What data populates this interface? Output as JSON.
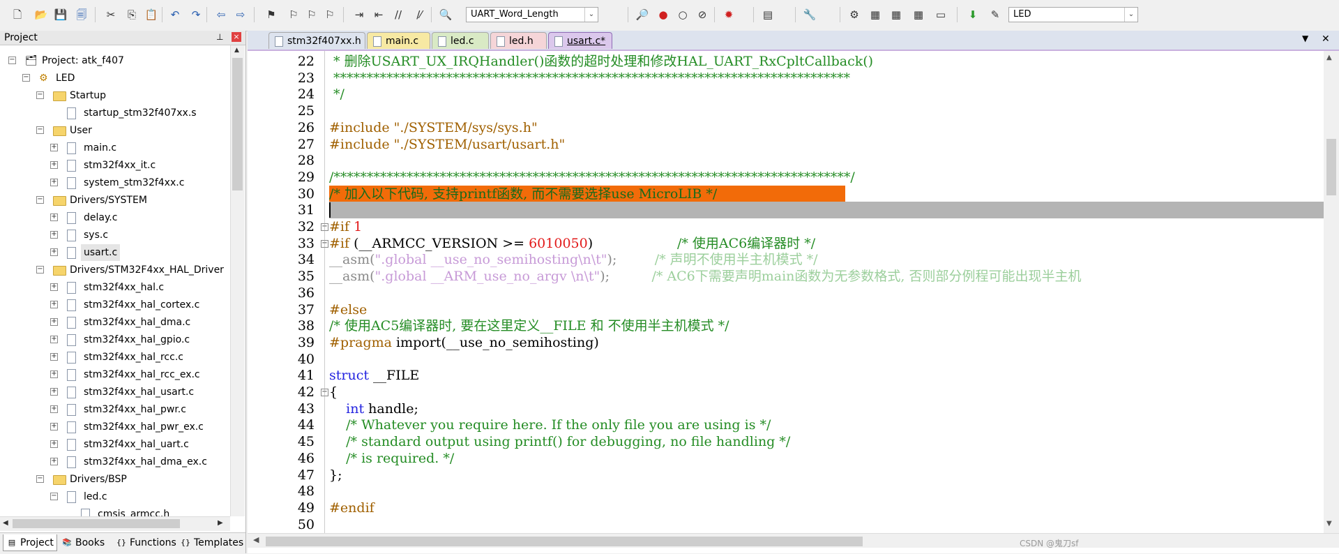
{
  "toolbar": {
    "target_combo": "UART_Word_Length",
    "project_combo": "LED",
    "icons": [
      "new-file-icon",
      "open-folder-icon",
      "save-icon",
      "save-all-icon",
      "cut-icon",
      "copy-icon",
      "paste-icon",
      "undo-icon",
      "redo-icon",
      "nav-back-icon",
      "nav-forward-icon",
      "bookmark-icon",
      "bookmark-prev-icon",
      "bookmark-next-icon",
      "bookmark-clear-icon",
      "indent-icon",
      "unindent-icon",
      "comment-icon",
      "uncomment-icon",
      "find-in-files-icon",
      "find-icon",
      "debug-start-icon",
      "breakpoint-icon",
      "breakpoint-disable-icon",
      "breakpoint-kill-icon",
      "window-layout-icon",
      "configure-icon",
      "translate-icon",
      "build-icon",
      "rebuild-icon",
      "batch-build-icon",
      "stop-build-icon",
      "download-icon",
      "target-options-icon",
      "manage-components-icon",
      "pack-installer-icon",
      "select-packs-icon",
      "run-env-icon"
    ]
  },
  "project_panel": {
    "title": "Project",
    "close_label": "×",
    "tree": [
      {
        "label": "Project: atk_f407",
        "depth": 0,
        "kind": "project",
        "expand": "−"
      },
      {
        "label": "LED",
        "depth": 1,
        "kind": "target",
        "expand": "−"
      },
      {
        "label": "Startup",
        "depth": 2,
        "kind": "folder",
        "expand": "−"
      },
      {
        "label": "startup_stm32f407xx.s",
        "depth": 3,
        "kind": "file",
        "expand": ""
      },
      {
        "label": "User",
        "depth": 2,
        "kind": "folder",
        "expand": "−"
      },
      {
        "label": "main.c",
        "depth": 3,
        "kind": "file",
        "expand": "+"
      },
      {
        "label": "stm32f4xx_it.c",
        "depth": 3,
        "kind": "file",
        "expand": "+"
      },
      {
        "label": "system_stm32f4xx.c",
        "depth": 3,
        "kind": "file",
        "expand": "+"
      },
      {
        "label": "Drivers/SYSTEM",
        "depth": 2,
        "kind": "folder",
        "expand": "−"
      },
      {
        "label": "delay.c",
        "depth": 3,
        "kind": "file",
        "expand": "+"
      },
      {
        "label": "sys.c",
        "depth": 3,
        "kind": "file",
        "expand": "+"
      },
      {
        "label": "usart.c",
        "depth": 3,
        "kind": "file",
        "expand": "+",
        "selected": true
      },
      {
        "label": "Drivers/STM32F4xx_HAL_Driver",
        "depth": 2,
        "kind": "folder",
        "expand": "−"
      },
      {
        "label": "stm32f4xx_hal.c",
        "depth": 3,
        "kind": "file",
        "expand": "+"
      },
      {
        "label": "stm32f4xx_hal_cortex.c",
        "depth": 3,
        "kind": "file",
        "expand": "+"
      },
      {
        "label": "stm32f4xx_hal_dma.c",
        "depth": 3,
        "kind": "file",
        "expand": "+"
      },
      {
        "label": "stm32f4xx_hal_gpio.c",
        "depth": 3,
        "kind": "file",
        "expand": "+"
      },
      {
        "label": "stm32f4xx_hal_rcc.c",
        "depth": 3,
        "kind": "file",
        "expand": "+"
      },
      {
        "label": "stm32f4xx_hal_rcc_ex.c",
        "depth": 3,
        "kind": "file",
        "expand": "+"
      },
      {
        "label": "stm32f4xx_hal_usart.c",
        "depth": 3,
        "kind": "file",
        "expand": "+"
      },
      {
        "label": "stm32f4xx_hal_pwr.c",
        "depth": 3,
        "kind": "file",
        "expand": "+"
      },
      {
        "label": "stm32f4xx_hal_pwr_ex.c",
        "depth": 3,
        "kind": "file",
        "expand": "+"
      },
      {
        "label": "stm32f4xx_hal_uart.c",
        "depth": 3,
        "kind": "file",
        "expand": "+"
      },
      {
        "label": "stm32f4xx_hal_dma_ex.c",
        "depth": 3,
        "kind": "file",
        "expand": "+"
      },
      {
        "label": "Drivers/BSP",
        "depth": 2,
        "kind": "folder",
        "expand": "−"
      },
      {
        "label": "led.c",
        "depth": 3,
        "kind": "file",
        "expand": "−"
      },
      {
        "label": "cmsis_armcc.h",
        "depth": 4,
        "kind": "file",
        "expand": ""
      }
    ],
    "bottom_tabs": [
      {
        "label": "Project",
        "icon": "project-tab-icon",
        "active": true
      },
      {
        "label": "Books",
        "icon": "books-tab-icon",
        "active": false
      },
      {
        "label": "Functions",
        "icon": "functions-tab-icon",
        "active": false
      },
      {
        "label": "Templates",
        "icon": "templates-tab-icon",
        "active": false
      }
    ]
  },
  "editor": {
    "tabs": [
      {
        "label": "stm32f407xx.h",
        "color": "#dde3ee",
        "active": false
      },
      {
        "label": "main.c",
        "color": "#f7e9a3",
        "active": false
      },
      {
        "label": "led.c",
        "color": "#d9eac5",
        "active": false
      },
      {
        "label": "led.h",
        "color": "#f5d5d8",
        "active": false
      },
      {
        "label": "usart.c*",
        "color": "#dbc8ec",
        "active": true
      }
    ],
    "tab_menu": "▼",
    "tab_close": "✕",
    "lines": [
      {
        "n": "22",
        "fold": "",
        "hl": "",
        "segs": [
          {
            "t": " * 删除USART_UX_IRQHandler()函数的超时处理和修改HAL_UART_RxCpltCallback()",
            "c": "#248c24"
          }
        ]
      },
      {
        "n": "23",
        "fold": "",
        "hl": "",
        "segs": [
          {
            "t": " ******************************************************************************",
            "c": "#248c24"
          }
        ]
      },
      {
        "n": "24",
        "fold": "",
        "hl": "",
        "segs": [
          {
            "t": " */",
            "c": "#248c24"
          }
        ]
      },
      {
        "n": "25",
        "fold": "",
        "hl": "",
        "segs": []
      },
      {
        "n": "26",
        "fold": "",
        "hl": "",
        "segs": [
          {
            "t": "#include ",
            "c": "#a06000"
          },
          {
            "t": "\"./SYSTEM/sys/sys.h\"",
            "c": "#a06000"
          }
        ]
      },
      {
        "n": "27",
        "fold": "",
        "hl": "",
        "segs": [
          {
            "t": "#include ",
            "c": "#a06000"
          },
          {
            "t": "\"./SYSTEM/usart/usart.h\"",
            "c": "#a06000"
          }
        ]
      },
      {
        "n": "28",
        "fold": "",
        "hl": "",
        "segs": []
      },
      {
        "n": "29",
        "fold": "",
        "hl": "",
        "segs": [
          {
            "t": "/******************************************************************************/",
            "c": "#248c24"
          }
        ]
      },
      {
        "n": "30",
        "fold": "",
        "hl": "orange",
        "segs": [
          {
            "t": "/* 加入以下代码, 支持printf函数, 而不需要选择use MicroLIB */",
            "c": "#1a6a1a"
          }
        ]
      },
      {
        "n": "31",
        "fold": "",
        "hl": "gray",
        "segs": []
      },
      {
        "n": "32",
        "fold": "−",
        "hl": "",
        "segs": [
          {
            "t": "#if ",
            "c": "#a06000"
          },
          {
            "t": "1",
            "c": "#e21a1a"
          }
        ]
      },
      {
        "n": "33",
        "fold": "−",
        "hl": "",
        "segs": [
          {
            "t": "#if ",
            "c": "#a06000"
          },
          {
            "t": "(__ARMCC_VERSION >= ",
            "c": "#000000"
          },
          {
            "t": "6010050",
            "c": "#e21a1a"
          },
          {
            "t": ")                    ",
            "c": "#000000"
          },
          {
            "t": "/* 使用AC6编译器时 */",
            "c": "#248c24"
          }
        ]
      },
      {
        "n": "34",
        "fold": "",
        "hl": "",
        "segs": [
          {
            "t": "__asm(",
            "c": "#8a8a8a"
          },
          {
            "t": "\".global __use_no_semihosting\\n\\t\"",
            "c": "#c79ad7"
          },
          {
            "t": ");         ",
            "c": "#8a8a8a"
          },
          {
            "t": "/* 声明不使用半主机模式 */",
            "c": "#9ccf9c"
          }
        ]
      },
      {
        "n": "35",
        "fold": "",
        "hl": "",
        "segs": [
          {
            "t": "__asm(",
            "c": "#8a8a8a"
          },
          {
            "t": "\".global __ARM_use_no_argv \\n\\t\"",
            "c": "#c79ad7"
          },
          {
            "t": ");          ",
            "c": "#8a8a8a"
          },
          {
            "t": "/* AC6下需要声明main函数为无参数格式, 否则部分例程可能出现半主机",
            "c": "#9ccf9c"
          }
        ]
      },
      {
        "n": "36",
        "fold": "",
        "hl": "",
        "segs": []
      },
      {
        "n": "37",
        "fold": "",
        "hl": "",
        "segs": [
          {
            "t": "#else",
            "c": "#a06000"
          }
        ]
      },
      {
        "n": "38",
        "fold": "",
        "hl": "",
        "segs": [
          {
            "t": "/* 使用AC5编译器时, 要在这里定义__FILE 和 不使用半主机模式 */",
            "c": "#248c24"
          }
        ]
      },
      {
        "n": "39",
        "fold": "",
        "hl": "",
        "segs": [
          {
            "t": "#pragma ",
            "c": "#a06000"
          },
          {
            "t": "import(__use_no_semihosting)",
            "c": "#000000"
          }
        ]
      },
      {
        "n": "40",
        "fold": "",
        "hl": "",
        "segs": []
      },
      {
        "n": "41",
        "fold": "",
        "hl": "",
        "segs": [
          {
            "t": "struct ",
            "c": "#2222e0"
          },
          {
            "t": "__FILE",
            "c": "#000000"
          }
        ]
      },
      {
        "n": "42",
        "fold": "−",
        "hl": "",
        "segs": [
          {
            "t": "{",
            "c": "#000000"
          }
        ]
      },
      {
        "n": "43",
        "fold": "",
        "hl": "",
        "segs": [
          {
            "t": "    ",
            "c": "#000000"
          },
          {
            "t": "int ",
            "c": "#2222e0"
          },
          {
            "t": "handle;",
            "c": "#000000"
          }
        ]
      },
      {
        "n": "44",
        "fold": "",
        "hl": "",
        "segs": [
          {
            "t": "    /* Whatever you require here. If the only file you are using is */",
            "c": "#248c24"
          }
        ]
      },
      {
        "n": "45",
        "fold": "",
        "hl": "",
        "segs": [
          {
            "t": "    /* standard output using printf() for debugging, no file handling */",
            "c": "#248c24"
          }
        ]
      },
      {
        "n": "46",
        "fold": "",
        "hl": "",
        "segs": [
          {
            "t": "    /* is required. */",
            "c": "#248c24"
          }
        ]
      },
      {
        "n": "47",
        "fold": "",
        "hl": "",
        "segs": [
          {
            "t": "};",
            "c": "#000000"
          }
        ]
      },
      {
        "n": "48",
        "fold": "",
        "hl": "",
        "segs": []
      },
      {
        "n": "49",
        "fold": "",
        "hl": "",
        "segs": [
          {
            "t": "#endif",
            "c": "#a06000"
          }
        ]
      },
      {
        "n": "50",
        "fold": "",
        "hl": "",
        "segs": []
      }
    ]
  },
  "watermark": "CSDN @鬼刀sf"
}
